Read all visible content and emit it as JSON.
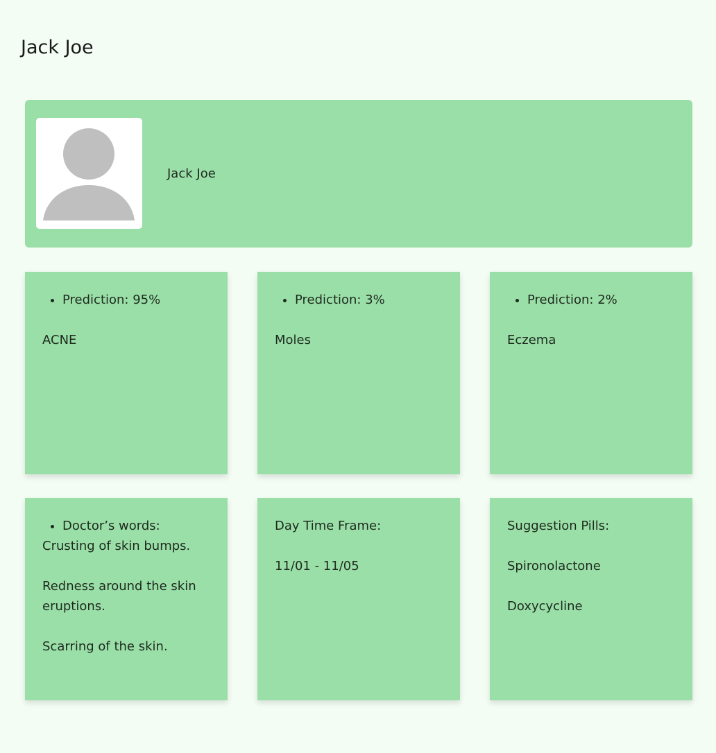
{
  "header": {
    "title": "Jack Joe"
  },
  "profile": {
    "name": "Jack Joe",
    "avatar_icon": "user-avatar-placeholder-icon"
  },
  "predictions": [
    {
      "label": "Prediction: 95%",
      "condition": "ACNE"
    },
    {
      "label": "Prediction: 3%",
      "condition": "Moles"
    },
    {
      "label": "Prediction: 2%",
      "condition": "Eczema"
    }
  ],
  "doctor": {
    "label": "Doctor’s words:",
    "lines": [
      "Crusting of skin bumps.",
      "Redness around the skin eruptions.",
      "Scarring of the skin."
    ]
  },
  "time_frame": {
    "label": "Day Time Frame:",
    "value": "11/01 - 11/05"
  },
  "pills": {
    "label": "Suggestion Pills:",
    "items": [
      "Spironolactone",
      "Doxycycline"
    ]
  },
  "colors": {
    "background": "#f3fdf4",
    "card": "#9bdfa8",
    "avatar_silhouette": "#bfbfbf"
  }
}
